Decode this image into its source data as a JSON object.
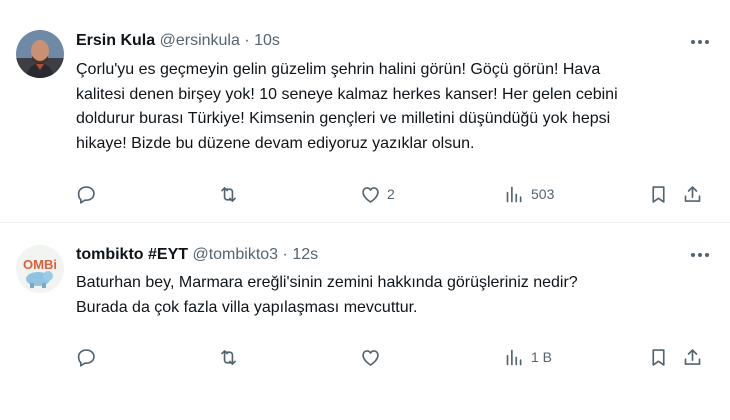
{
  "tweets": [
    {
      "name": "Ersin Kula",
      "handle": "@ersinkula",
      "separator": "·",
      "time": "10s",
      "text_lines": [
        "Çorlu'yu es geçmeyin gelin güzelim şehrin halini görün! Göçü görün! Hava",
        "kalitesi denen birşey yok! 10 seneye kalmaz herkes kanser! Her gelen cebini",
        "doldurur burası Türkiye! Kimsenin gençleri ve milletini düşündüğü yok hepsi",
        "hikaye! Bizde bu düzene devam ediyoruz yazıklar olsun."
      ],
      "replies": "",
      "retweets": "",
      "likes": "2",
      "views": "503"
    },
    {
      "name": "tombikto #EYT",
      "handle": "@tombikto3",
      "separator": "·",
      "time": "12s",
      "text_lines": [
        "Baturhan bey, Marmara ereğli'sinin zemini hakkında görüşleriniz nedir?",
        "Burada da çok fazla villa yapılaşması mevcuttur."
      ],
      "replies": "",
      "retweets": "",
      "likes": "",
      "views": "1 B"
    }
  ],
  "icons": {
    "more": "more-horizontal-icon",
    "reply": "reply-icon",
    "retweet": "retweet-icon",
    "like": "heart-icon",
    "views": "views-icon",
    "bookmark": "bookmark-icon",
    "share": "share-icon"
  },
  "colors": {
    "text": "#0f1419",
    "secondary": "#536471",
    "divider": "#eff3f4"
  }
}
